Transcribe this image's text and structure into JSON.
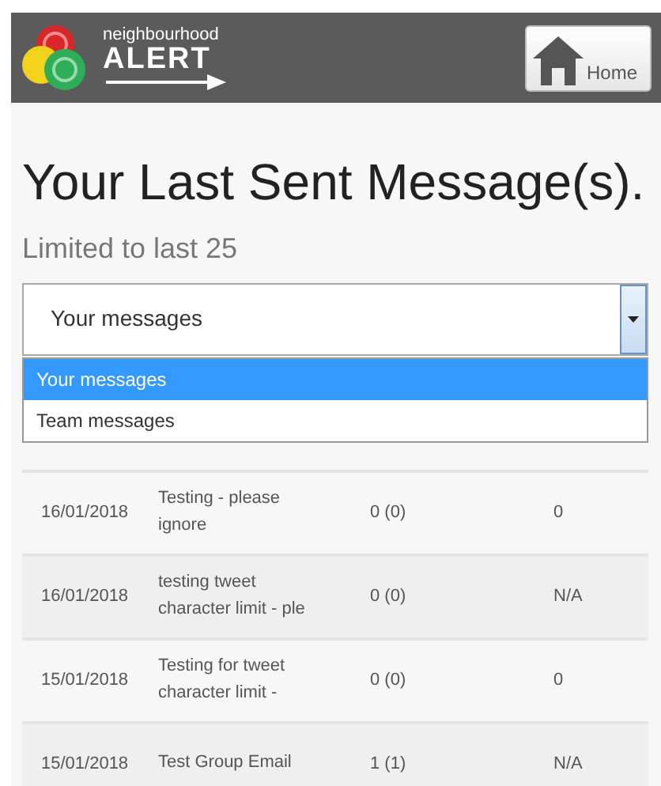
{
  "header": {
    "logo_top": "neighbourhood",
    "logo_main": "ALERT",
    "home_button": "Home"
  },
  "title": "Your Last Sent Message(s).",
  "subtitle": "Limited to last 25",
  "select": {
    "value": "Your messages",
    "expanded": true,
    "options": [
      {
        "label": "Your messages",
        "selected": true
      },
      {
        "label": "Team messages",
        "selected": false
      }
    ]
  },
  "table": {
    "rows": [
      {
        "date": "16/01/2018",
        "message": "Testing - please ignore",
        "count": "0 (0)",
        "column_4": "0"
      },
      {
        "date": "16/01/2018",
        "message": "testing tweet character limit - ple",
        "count": "0 (0)",
        "column_4": "N/A"
      },
      {
        "date": "15/01/2018",
        "message": "Testing for tweet character limit -",
        "count": "0 (0)",
        "column_4": "0"
      },
      {
        "date": "15/01/2018",
        "message": "Test Group Email",
        "count": "1 (1)",
        "column_4": "N/A"
      }
    ]
  }
}
